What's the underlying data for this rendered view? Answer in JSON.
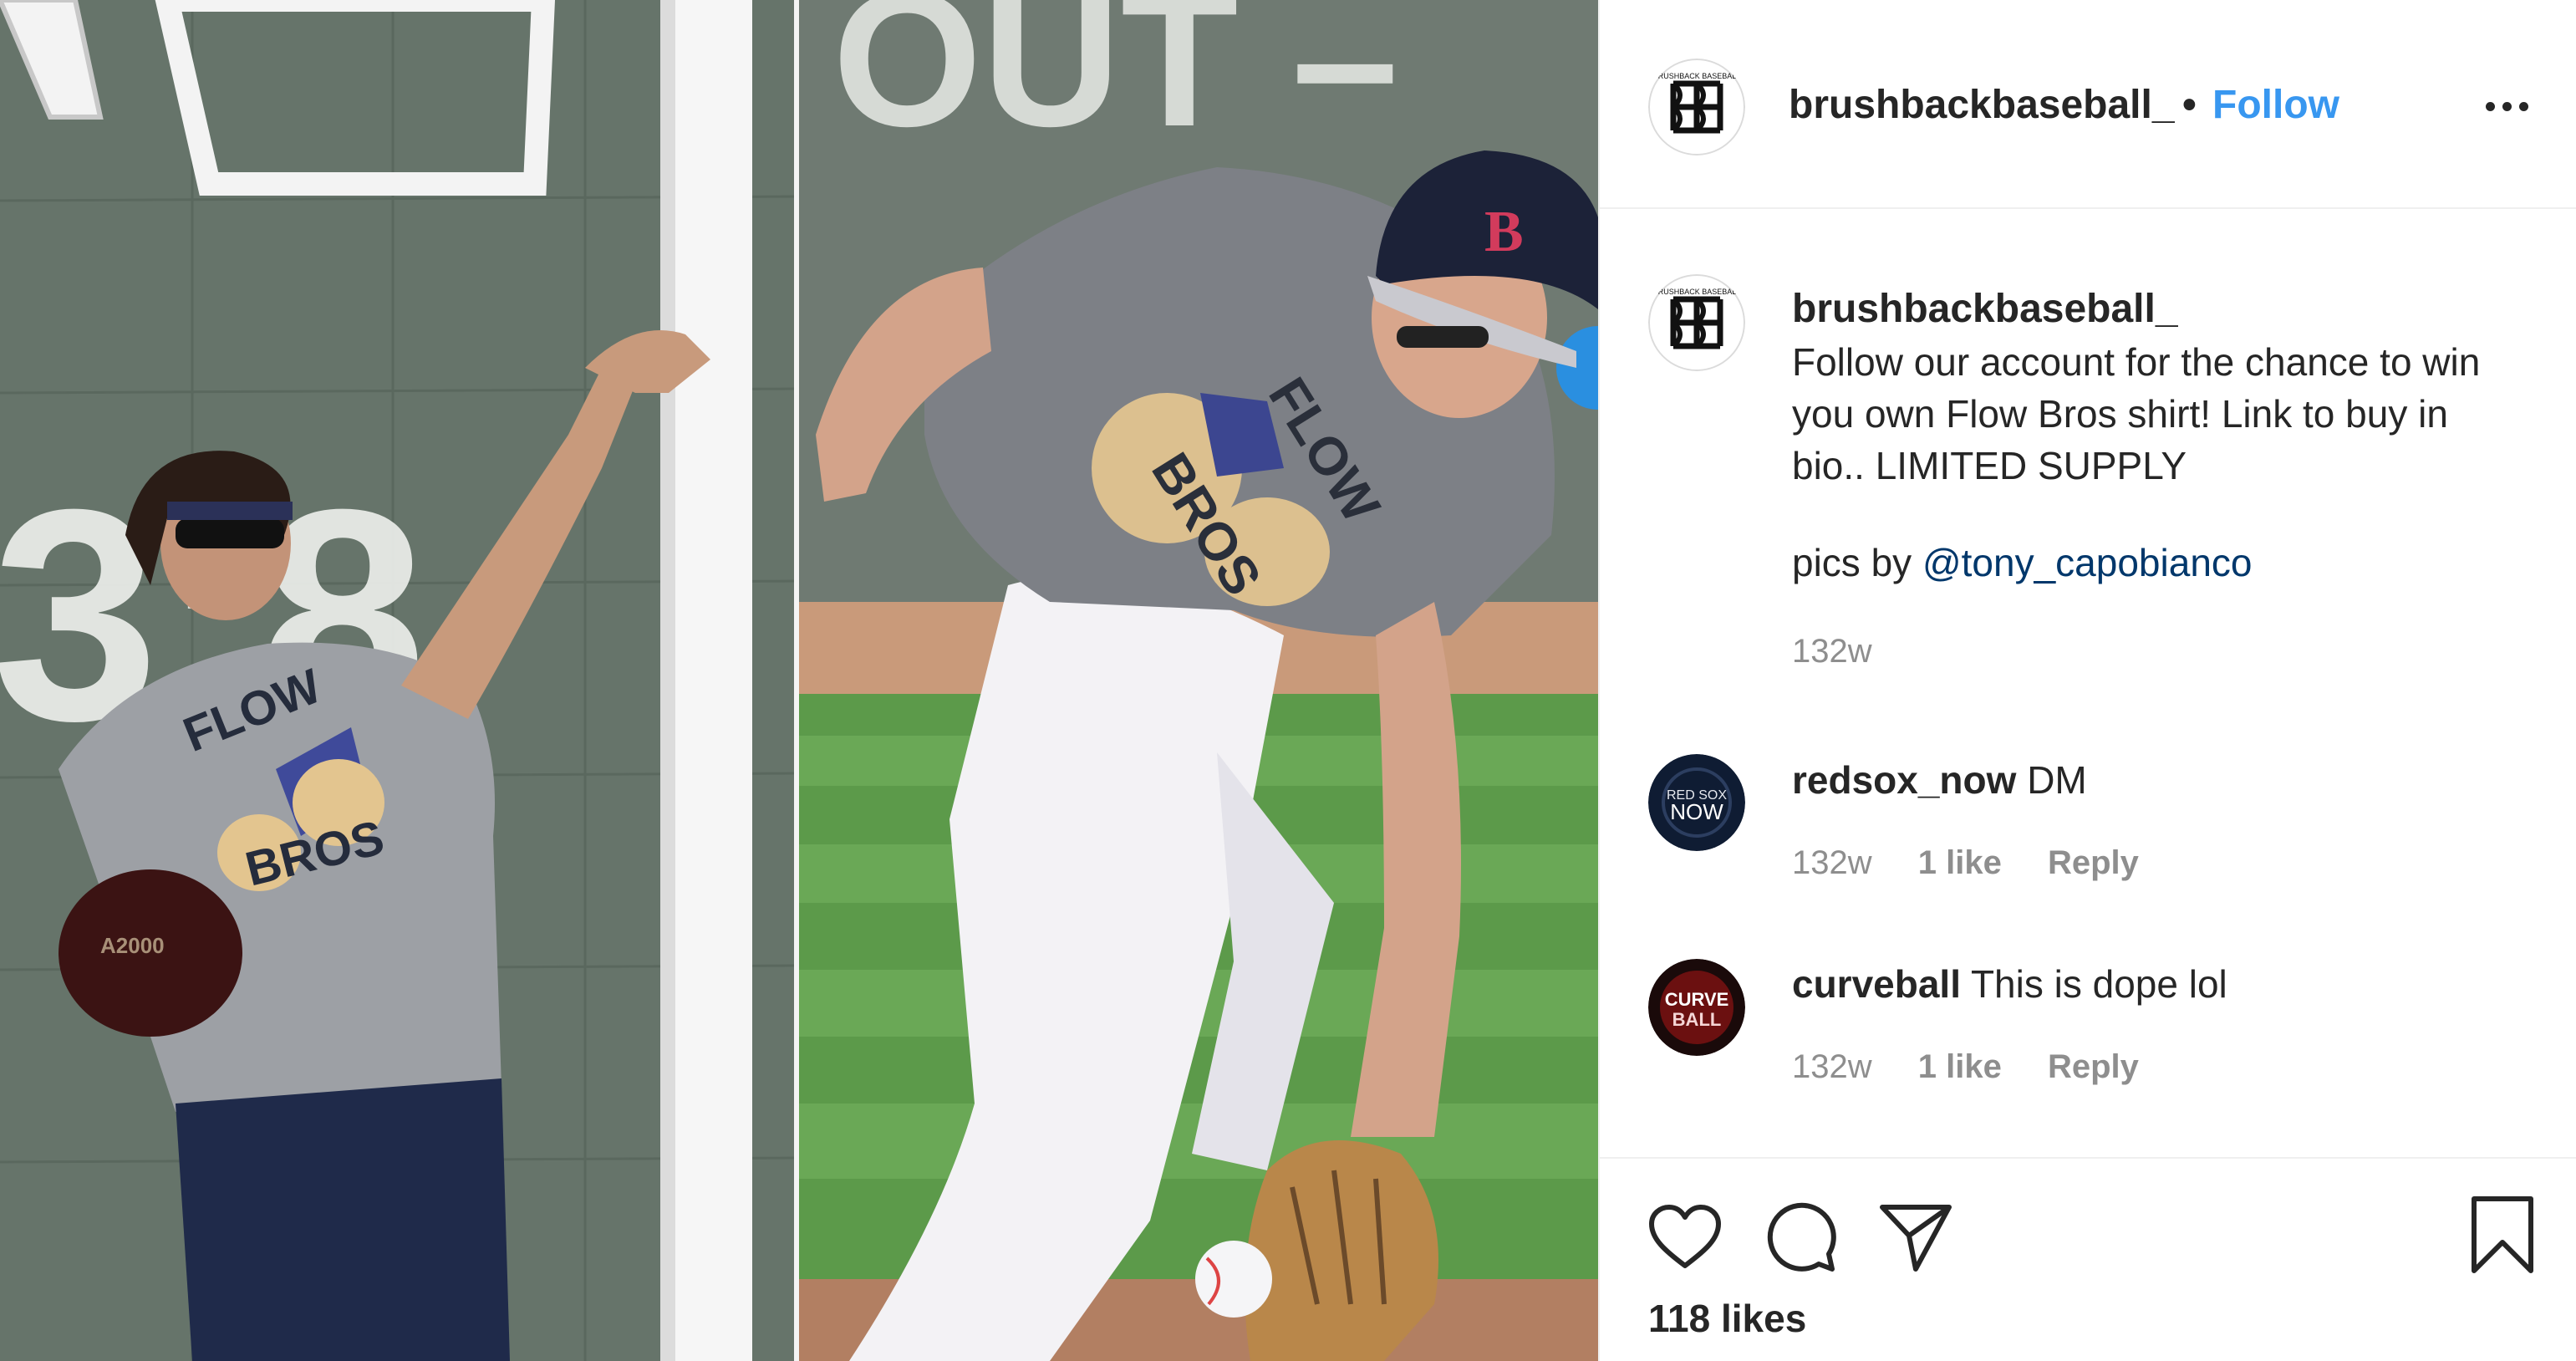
{
  "post": {
    "author": "brushbackbaseball_",
    "separator": "•",
    "follow_label": "Follow",
    "avatar_icon": "brushback-bb-logo-icon",
    "avatar_arc_text": "BRUSHBACK BASEBALL"
  },
  "photos": {
    "left_shirt_text_1": "FLOW",
    "left_shirt_text_2": "BROS",
    "left_wall_text": "3:8",
    "left_glove_text": "A2000",
    "right_wall_text": "OUT –",
    "right_shirt_text_1": "FLOW",
    "right_shirt_text_2": "BROS"
  },
  "caption": {
    "username": "brushbackbaseball_",
    "text": "Follow our account for the chance to win\nyou own Flow Bros shirt! Link to buy in\nbio.. LIMITED SUPPLY",
    "credit_prefix": "pics by",
    "mention": "@tony_capobianco",
    "time": "132w"
  },
  "comments": [
    {
      "username": "redsox_now",
      "text": "DM",
      "time": "132w",
      "likes": "1 like",
      "reply": "Reply",
      "avatar_line1": "RED SOX",
      "avatar_line2": "NOW"
    },
    {
      "username": "curveball",
      "text": "This is dope lol",
      "time": "132w",
      "likes": "1 like",
      "reply": "Reply",
      "avatar_line1": "CURVE",
      "avatar_line2": "BALL"
    }
  ],
  "actions": {
    "icons": [
      "heart-icon",
      "comment-icon",
      "share-icon",
      "bookmark-icon"
    ],
    "likes": "118 likes"
  },
  "colors": {
    "accent_blue": "#3897f0",
    "mention_blue": "#00376b",
    "muted_gray": "#8e8e8e",
    "text": "#262626",
    "divider": "#efefef"
  }
}
